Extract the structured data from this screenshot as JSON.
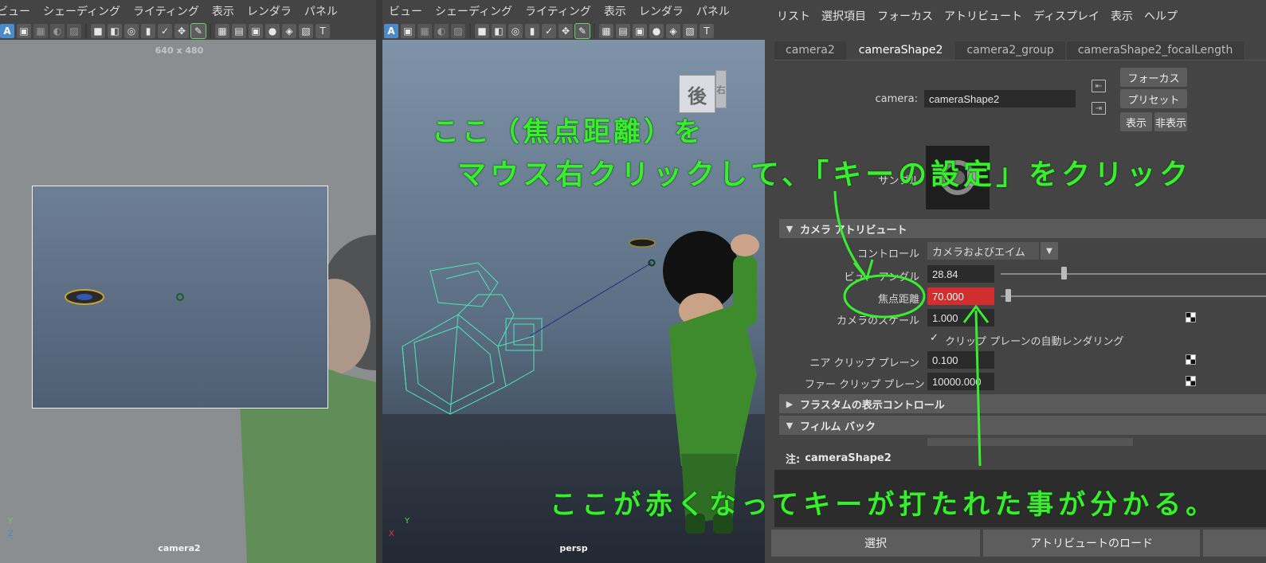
{
  "viewports": {
    "menu": [
      "ビュー",
      "シェーディング",
      "ライティング",
      "表示",
      "レンダラ",
      "パネル"
    ],
    "left": {
      "resolution": "640 x 480",
      "camera_name": "camera2",
      "axis_y": "Y",
      "axis_z": "Z"
    },
    "right": {
      "camera_name": "persp",
      "cube_face_front": "後",
      "cube_face_side": "右",
      "axis_x": "X",
      "axis_y": "Y"
    }
  },
  "attribute_editor": {
    "menu": [
      "リスト",
      "選択項目",
      "フォーカス",
      "アトリビュート",
      "ディスプレイ",
      "表示",
      "ヘルプ"
    ],
    "tabs": [
      "camera2",
      "cameraShape2",
      "camera2_group",
      "cameraShape2_focalLength"
    ],
    "active_tab": "cameraShape2",
    "node_label": "camera:",
    "node_value": "cameraShape2",
    "buttons": {
      "focus": "フォーカス",
      "preset": "プリセット",
      "show": "表示",
      "hide": "非表示"
    },
    "sample_label": "サンプル",
    "sections": {
      "camera_attributes": "カメラ アトリビュート",
      "frustum": "フラスタムの表示コントロール",
      "film_back": "フィルム バック"
    },
    "fields": {
      "controls_label": "コントロール",
      "controls_value": "カメラおよびエイム",
      "angle_of_view_label": "ビュー アングル",
      "angle_of_view_value": "28.84",
      "focal_length_label": "焦点距離",
      "focal_length_value": "70.000",
      "camera_scale_label": "カメラのスケール",
      "camera_scale_value": "1.000",
      "auto_render_clip_label": "クリップ プレーンの自動レンダリング",
      "auto_render_clip_checked": "✓",
      "near_clip_label": "ニア クリップ プレーン",
      "near_clip_value": "0.100",
      "far_clip_label": "ファー クリップ プレーン",
      "far_clip_value": "10000.000"
    },
    "keyed_color": "#d32e2e",
    "notes_label": "注:",
    "notes_value": "cameraShape2",
    "bottom": {
      "select": "選択",
      "load_attributes": "アトリビュートのロード"
    }
  },
  "annotations": {
    "line1": "ここ（焦点距離）を",
    "line2": "マウス右クリックして、「キーの設定」をクリック",
    "line3": "ここが赤くなってキーが打たれた事が分かる。",
    "color": "#3aed2e"
  }
}
